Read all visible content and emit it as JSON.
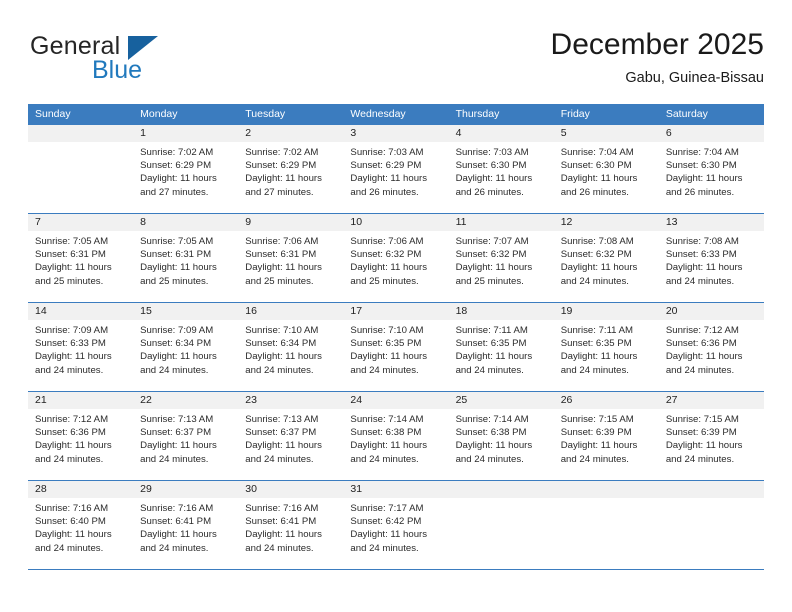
{
  "brand": {
    "name_part1": "General",
    "name_part2": "Blue",
    "accent_color": "#2179bd",
    "triangle_color": "#17619e",
    "triangle_icon": "triangle-icon"
  },
  "header": {
    "title": "December 2025",
    "subtitle": "Gabu, Guinea-Bissau"
  },
  "theme": {
    "header_blue": "#3b7cbf",
    "daynum_background": "#f1f1f1",
    "separator_blue": "#3b7cbf",
    "text_color": "#2b2b2b"
  },
  "weekday_headers": [
    "Sunday",
    "Monday",
    "Tuesday",
    "Wednesday",
    "Thursday",
    "Friday",
    "Saturday"
  ],
  "weeks": [
    {
      "days": [
        {
          "number": "",
          "sunrise": "",
          "sunset": "",
          "daylight_line1": "",
          "daylight_line2": "",
          "empty": true
        },
        {
          "number": "1",
          "sunrise": "Sunrise: 7:02 AM",
          "sunset": "Sunset: 6:29 PM",
          "daylight_line1": "Daylight: 11 hours",
          "daylight_line2": "and 27 minutes.",
          "empty": false
        },
        {
          "number": "2",
          "sunrise": "Sunrise: 7:02 AM",
          "sunset": "Sunset: 6:29 PM",
          "daylight_line1": "Daylight: 11 hours",
          "daylight_line2": "and 27 minutes.",
          "empty": false
        },
        {
          "number": "3",
          "sunrise": "Sunrise: 7:03 AM",
          "sunset": "Sunset: 6:29 PM",
          "daylight_line1": "Daylight: 11 hours",
          "daylight_line2": "and 26 minutes.",
          "empty": false
        },
        {
          "number": "4",
          "sunrise": "Sunrise: 7:03 AM",
          "sunset": "Sunset: 6:30 PM",
          "daylight_line1": "Daylight: 11 hours",
          "daylight_line2": "and 26 minutes.",
          "empty": false
        },
        {
          "number": "5",
          "sunrise": "Sunrise: 7:04 AM",
          "sunset": "Sunset: 6:30 PM",
          "daylight_line1": "Daylight: 11 hours",
          "daylight_line2": "and 26 minutes.",
          "empty": false
        },
        {
          "number": "6",
          "sunrise": "Sunrise: 7:04 AM",
          "sunset": "Sunset: 6:30 PM",
          "daylight_line1": "Daylight: 11 hours",
          "daylight_line2": "and 26 minutes.",
          "empty": false
        }
      ]
    },
    {
      "days": [
        {
          "number": "7",
          "sunrise": "Sunrise: 7:05 AM",
          "sunset": "Sunset: 6:31 PM",
          "daylight_line1": "Daylight: 11 hours",
          "daylight_line2": "and 25 minutes.",
          "empty": false
        },
        {
          "number": "8",
          "sunrise": "Sunrise: 7:05 AM",
          "sunset": "Sunset: 6:31 PM",
          "daylight_line1": "Daylight: 11 hours",
          "daylight_line2": "and 25 minutes.",
          "empty": false
        },
        {
          "number": "9",
          "sunrise": "Sunrise: 7:06 AM",
          "sunset": "Sunset: 6:31 PM",
          "daylight_line1": "Daylight: 11 hours",
          "daylight_line2": "and 25 minutes.",
          "empty": false
        },
        {
          "number": "10",
          "sunrise": "Sunrise: 7:06 AM",
          "sunset": "Sunset: 6:32 PM",
          "daylight_line1": "Daylight: 11 hours",
          "daylight_line2": "and 25 minutes.",
          "empty": false
        },
        {
          "number": "11",
          "sunrise": "Sunrise: 7:07 AM",
          "sunset": "Sunset: 6:32 PM",
          "daylight_line1": "Daylight: 11 hours",
          "daylight_line2": "and 25 minutes.",
          "empty": false
        },
        {
          "number": "12",
          "sunrise": "Sunrise: 7:08 AM",
          "sunset": "Sunset: 6:32 PM",
          "daylight_line1": "Daylight: 11 hours",
          "daylight_line2": "and 24 minutes.",
          "empty": false
        },
        {
          "number": "13",
          "sunrise": "Sunrise: 7:08 AM",
          "sunset": "Sunset: 6:33 PM",
          "daylight_line1": "Daylight: 11 hours",
          "daylight_line2": "and 24 minutes.",
          "empty": false
        }
      ]
    },
    {
      "days": [
        {
          "number": "14",
          "sunrise": "Sunrise: 7:09 AM",
          "sunset": "Sunset: 6:33 PM",
          "daylight_line1": "Daylight: 11 hours",
          "daylight_line2": "and 24 minutes.",
          "empty": false
        },
        {
          "number": "15",
          "sunrise": "Sunrise: 7:09 AM",
          "sunset": "Sunset: 6:34 PM",
          "daylight_line1": "Daylight: 11 hours",
          "daylight_line2": "and 24 minutes.",
          "empty": false
        },
        {
          "number": "16",
          "sunrise": "Sunrise: 7:10 AM",
          "sunset": "Sunset: 6:34 PM",
          "daylight_line1": "Daylight: 11 hours",
          "daylight_line2": "and 24 minutes.",
          "empty": false
        },
        {
          "number": "17",
          "sunrise": "Sunrise: 7:10 AM",
          "sunset": "Sunset: 6:35 PM",
          "daylight_line1": "Daylight: 11 hours",
          "daylight_line2": "and 24 minutes.",
          "empty": false
        },
        {
          "number": "18",
          "sunrise": "Sunrise: 7:11 AM",
          "sunset": "Sunset: 6:35 PM",
          "daylight_line1": "Daylight: 11 hours",
          "daylight_line2": "and 24 minutes.",
          "empty": false
        },
        {
          "number": "19",
          "sunrise": "Sunrise: 7:11 AM",
          "sunset": "Sunset: 6:35 PM",
          "daylight_line1": "Daylight: 11 hours",
          "daylight_line2": "and 24 minutes.",
          "empty": false
        },
        {
          "number": "20",
          "sunrise": "Sunrise: 7:12 AM",
          "sunset": "Sunset: 6:36 PM",
          "daylight_line1": "Daylight: 11 hours",
          "daylight_line2": "and 24 minutes.",
          "empty": false
        }
      ]
    },
    {
      "days": [
        {
          "number": "21",
          "sunrise": "Sunrise: 7:12 AM",
          "sunset": "Sunset: 6:36 PM",
          "daylight_line1": "Daylight: 11 hours",
          "daylight_line2": "and 24 minutes.",
          "empty": false
        },
        {
          "number": "22",
          "sunrise": "Sunrise: 7:13 AM",
          "sunset": "Sunset: 6:37 PM",
          "daylight_line1": "Daylight: 11 hours",
          "daylight_line2": "and 24 minutes.",
          "empty": false
        },
        {
          "number": "23",
          "sunrise": "Sunrise: 7:13 AM",
          "sunset": "Sunset: 6:37 PM",
          "daylight_line1": "Daylight: 11 hours",
          "daylight_line2": "and 24 minutes.",
          "empty": false
        },
        {
          "number": "24",
          "sunrise": "Sunrise: 7:14 AM",
          "sunset": "Sunset: 6:38 PM",
          "daylight_line1": "Daylight: 11 hours",
          "daylight_line2": "and 24 minutes.",
          "empty": false
        },
        {
          "number": "25",
          "sunrise": "Sunrise: 7:14 AM",
          "sunset": "Sunset: 6:38 PM",
          "daylight_line1": "Daylight: 11 hours",
          "daylight_line2": "and 24 minutes.",
          "empty": false
        },
        {
          "number": "26",
          "sunrise": "Sunrise: 7:15 AM",
          "sunset": "Sunset: 6:39 PM",
          "daylight_line1": "Daylight: 11 hours",
          "daylight_line2": "and 24 minutes.",
          "empty": false
        },
        {
          "number": "27",
          "sunrise": "Sunrise: 7:15 AM",
          "sunset": "Sunset: 6:39 PM",
          "daylight_line1": "Daylight: 11 hours",
          "daylight_line2": "and 24 minutes.",
          "empty": false
        }
      ]
    },
    {
      "days": [
        {
          "number": "28",
          "sunrise": "Sunrise: 7:16 AM",
          "sunset": "Sunset: 6:40 PM",
          "daylight_line1": "Daylight: 11 hours",
          "daylight_line2": "and 24 minutes.",
          "empty": false
        },
        {
          "number": "29",
          "sunrise": "Sunrise: 7:16 AM",
          "sunset": "Sunset: 6:41 PM",
          "daylight_line1": "Daylight: 11 hours",
          "daylight_line2": "and 24 minutes.",
          "empty": false
        },
        {
          "number": "30",
          "sunrise": "Sunrise: 7:16 AM",
          "sunset": "Sunset: 6:41 PM",
          "daylight_line1": "Daylight: 11 hours",
          "daylight_line2": "and 24 minutes.",
          "empty": false
        },
        {
          "number": "31",
          "sunrise": "Sunrise: 7:17 AM",
          "sunset": "Sunset: 6:42 PM",
          "daylight_line1": "Daylight: 11 hours",
          "daylight_line2": "and 24 minutes.",
          "empty": false
        },
        {
          "number": "",
          "sunrise": "",
          "sunset": "",
          "daylight_line1": "",
          "daylight_line2": "",
          "empty": true
        },
        {
          "number": "",
          "sunrise": "",
          "sunset": "",
          "daylight_line1": "",
          "daylight_line2": "",
          "empty": true
        },
        {
          "number": "",
          "sunrise": "",
          "sunset": "",
          "daylight_line1": "",
          "daylight_line2": "",
          "empty": true
        }
      ]
    }
  ]
}
